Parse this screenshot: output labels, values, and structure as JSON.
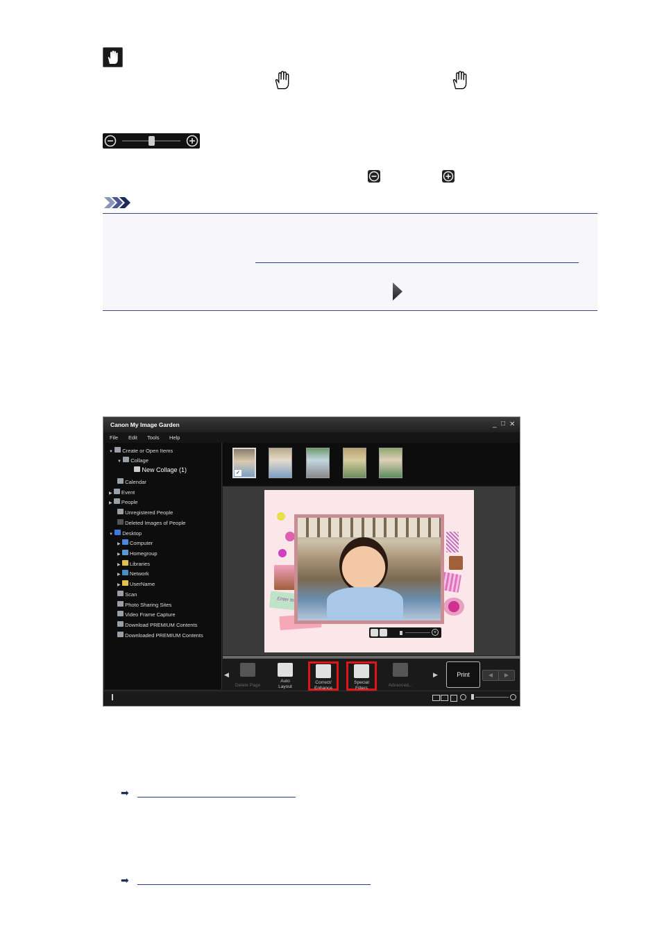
{
  "icons": {
    "hand": "hand-icon",
    "minus": "zoom-out-icon",
    "plus": "zoom-in-icon",
    "note": "note-icon",
    "next": "next-arrow-icon",
    "link_arrow": "link-arrow-icon"
  },
  "slider": {
    "level": 0.5
  },
  "app": {
    "title": "Canon My Image Garden",
    "window_controls": {
      "minimize": "_",
      "maximize": "□",
      "close": "✕"
    },
    "menu": [
      "File",
      "Edit",
      "Tools",
      "Help"
    ],
    "tree": [
      {
        "label": "Create or Open Items",
        "expanded": true,
        "level": 0
      },
      {
        "label": "Collage",
        "expanded": true,
        "level": 1
      },
      {
        "label": "New Collage (1)",
        "level": 2,
        "selected": true
      },
      {
        "label": "Calendar",
        "level": 0
      },
      {
        "label": "Event",
        "level": 0,
        "collapsed": true
      },
      {
        "label": "People",
        "level": 0,
        "collapsed": true
      },
      {
        "label": "Unregistered People",
        "level": 0
      },
      {
        "label": "Deleted Images of People",
        "level": 0
      },
      {
        "label": "Desktop",
        "level": 0,
        "expanded": true
      },
      {
        "label": "Computer",
        "level": 1,
        "collapsed": true
      },
      {
        "label": "Homegroup",
        "level": 1,
        "collapsed": true
      },
      {
        "label": "Libraries",
        "level": 1,
        "collapsed": true
      },
      {
        "label": "Network",
        "level": 1,
        "collapsed": true
      },
      {
        "label": "UserName",
        "level": 1,
        "collapsed": true
      },
      {
        "label": "Scan",
        "level": 0
      },
      {
        "label": "Photo Sharing Sites",
        "level": 0
      },
      {
        "label": "Video Frame Capture",
        "level": 0
      },
      {
        "label": "Download PREMIUM Contents",
        "level": 0
      },
      {
        "label": "Downloaded PREMIUM Contents",
        "level": 0
      }
    ],
    "sticker_text": "Enter text",
    "toolbar": {
      "delete_page": "Delete Page",
      "auto_layout_1": "Auto",
      "auto_layout_2": "Layout",
      "correct_1": "Correct/",
      "correct_2": "Enhance",
      "special_1": "Special",
      "special_2": "Filters",
      "advanced": "Advanced...",
      "print": "Print"
    },
    "highlight_color": "#e01515"
  }
}
